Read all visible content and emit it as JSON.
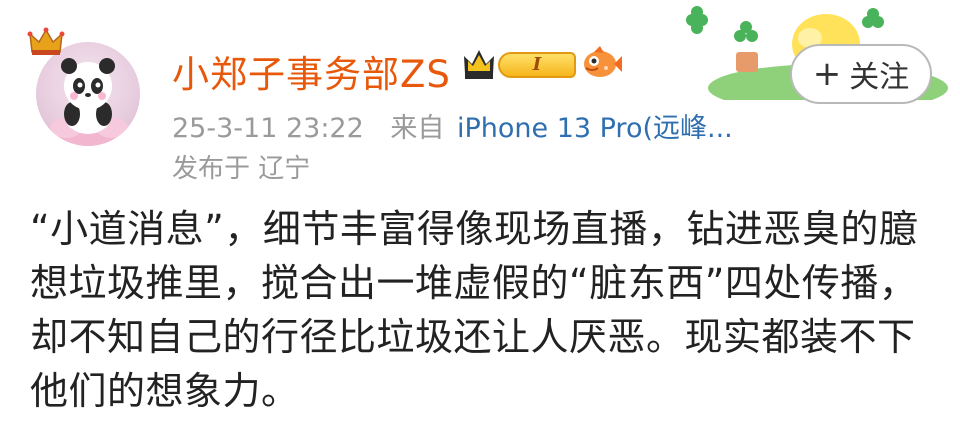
{
  "user": {
    "name": "小郑子事务部ZS",
    "level_badge": "I",
    "avatar_icon": "panda-avatar",
    "crown_icon": "crown-icon"
  },
  "post": {
    "time": "25-3-11 23:22",
    "source_label": "来自",
    "device": "iPhone 13 Pro(远峰...",
    "location": "发布于 辽宁",
    "text": "“小道消息”，细节丰富得像现场直播，钻进恶臭的臆想垃圾推里，搅合出一堆虚假的“脏东西”四处传播，却不知自己的行径比垃圾还让人厌恶。现实都装不下他们的想象力。"
  },
  "follow": {
    "plus": "+",
    "label": "关注"
  },
  "colors": {
    "username": "#e8580a",
    "meta": "#9a9a9a",
    "device": "#2f6fb0",
    "text": "#222222"
  }
}
